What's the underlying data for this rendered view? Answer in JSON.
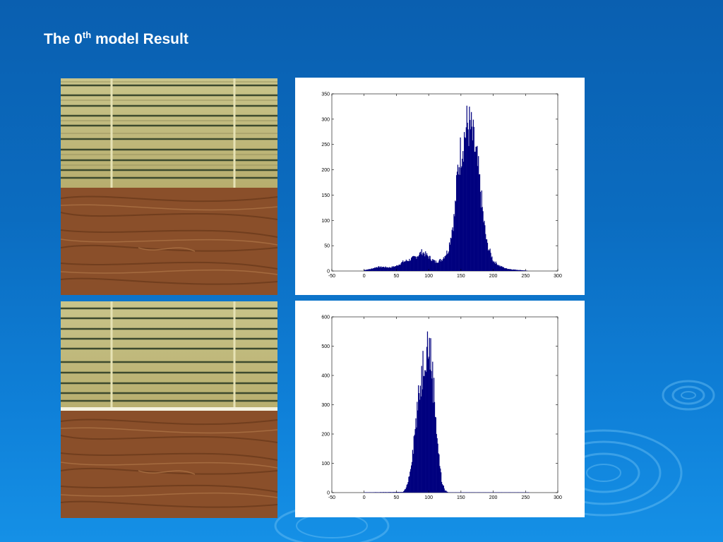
{
  "slide": {
    "title_main": "The 0",
    "title_sup": "th",
    "title_rest": " model Result"
  },
  "colors": {
    "bar": "#00007f",
    "background_top": "#0a5fb0",
    "background_bottom": "#1590e6"
  },
  "images": [
    {
      "name": "original-texture",
      "content": "bamboo mat over wood grain"
    },
    {
      "name": "segmented-texture",
      "content": "bamboo mat over wood grain"
    }
  ],
  "chart_data": [
    {
      "type": "bar",
      "xlim": [
        -50,
        300
      ],
      "ylim": [
        0,
        350
      ],
      "xticks": [
        -50,
        0,
        50,
        100,
        150,
        200,
        250,
        300
      ],
      "yticks": [
        0,
        50,
        100,
        150,
        200,
        250,
        300,
        350
      ],
      "grid": false,
      "distribution": {
        "x": [
          0,
          10,
          20,
          30,
          40,
          50,
          60,
          70,
          80,
          90,
          100,
          110,
          120,
          130,
          140,
          145,
          150,
          155,
          160,
          165,
          170,
          175,
          180,
          185,
          190,
          200,
          210,
          220,
          230,
          240,
          250,
          255
        ],
        "y": [
          2,
          4,
          8,
          8,
          7,
          10,
          18,
          22,
          28,
          38,
          28,
          18,
          22,
          40,
          110,
          200,
          240,
          265,
          290,
          280,
          250,
          215,
          160,
          100,
          55,
          20,
          10,
          5,
          3,
          2,
          1,
          0
        ]
      }
    },
    {
      "type": "bar",
      "xlim": [
        -50,
        300
      ],
      "ylim": [
        0,
        600
      ],
      "xticks": [
        -50,
        0,
        50,
        100,
        150,
        200,
        250,
        300
      ],
      "yticks": [
        0,
        100,
        200,
        300,
        400,
        500,
        600
      ],
      "grid": false,
      "distribution": {
        "x": [
          0,
          60,
          65,
          70,
          75,
          80,
          85,
          90,
          95,
          100,
          105,
          110,
          115,
          120,
          125,
          130,
          255
        ],
        "y": [
          1,
          2,
          15,
          60,
          140,
          240,
          330,
          420,
          500,
          510,
          430,
          290,
          140,
          40,
          8,
          1,
          1
        ]
      }
    }
  ]
}
